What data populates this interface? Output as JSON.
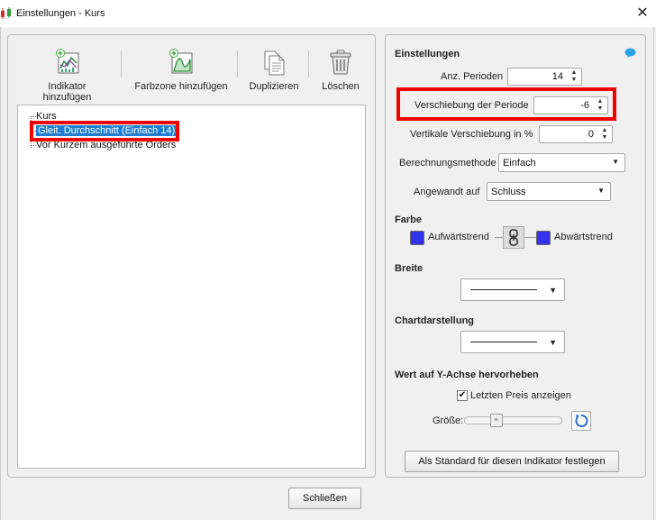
{
  "window": {
    "title": "Einstellungen - Kurs",
    "close_glyph": "✕"
  },
  "toolbar": {
    "add_indicator": "Indikator hinzufügen",
    "add_color_zone": "Farbzone hinzufügen",
    "duplicate": "Duplizieren",
    "delete": "Löschen"
  },
  "tree": {
    "items": [
      {
        "label": "Kurs",
        "selected": false
      },
      {
        "label": "Gleit. Durchschnitt (Einfach 14)",
        "selected": true
      },
      {
        "label": "Vor Kurzem ausgeführte Orders",
        "selected": false
      }
    ]
  },
  "settings": {
    "heading": "Einstellungen",
    "periods_label": "Anz. Perioden",
    "periods_value": "14",
    "shift_label": "Verschiebung der Periode",
    "shift_value": "-6",
    "vshift_label": "Vertikale Verschiebung in %",
    "vshift_value": "0",
    "method_label": "Berechnungsmethode",
    "method_value": "Einfach",
    "applied_label": "Angewandt auf",
    "applied_value": "Schluss",
    "color_heading": "Farbe",
    "uptrend_label": "Aufwärtstrend",
    "downtrend_label": "Abwärtstrend",
    "uptrend_color": "#3333ee",
    "downtrend_color": "#3333ee",
    "width_heading": "Breite",
    "chart_heading": "Chartdarstellung",
    "yaxis_heading": "Wert auf Y-Achse hervorheben",
    "show_last_price_label": "Letzten Preis anzeigen",
    "show_last_price_checked": true,
    "size_label": "Größe:",
    "size_slider_level": 0.3,
    "default_button": "Als Standard für diesen Indikator festlegen"
  },
  "footer": {
    "close_button": "Schließen"
  },
  "icons": [
    "app-chart-icon",
    "add-indicator-icon",
    "add-color-zone-icon",
    "duplicate-icon",
    "trash-icon",
    "help-chat-icon",
    "link-chain-icon",
    "reset-icon"
  ],
  "colors": {
    "highlight": "#f00000",
    "selection": "#1e7fd0"
  }
}
